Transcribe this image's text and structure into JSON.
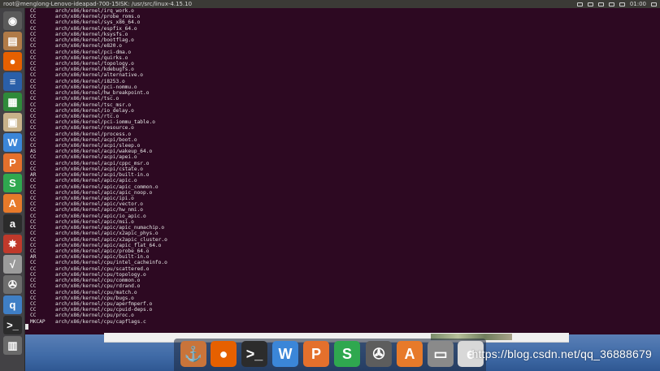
{
  "topbar": {
    "title": "root@menglong-Lenovo-ideapad-700-15ISK: /usr/src/linux-4.15.10",
    "clock": "01:00"
  },
  "terminal": {
    "lines": [
      {
        "action": "CC",
        "target": "arch/x86/kernel/irq_work.o"
      },
      {
        "action": "CC",
        "target": "arch/x86/kernel/probe_roms.o"
      },
      {
        "action": "CC",
        "target": "arch/x86/kernel/sys_x86_64.o"
      },
      {
        "action": "CC",
        "target": "arch/x86/kernel/espfix_64.o"
      },
      {
        "action": "CC",
        "target": "arch/x86/kernel/ksysfs.o"
      },
      {
        "action": "CC",
        "target": "arch/x86/kernel/bootflag.o"
      },
      {
        "action": "CC",
        "target": "arch/x86/kernel/e820.o"
      },
      {
        "action": "CC",
        "target": "arch/x86/kernel/pci-dma.o"
      },
      {
        "action": "CC",
        "target": "arch/x86/kernel/quirks.o"
      },
      {
        "action": "CC",
        "target": "arch/x86/kernel/topology.o"
      },
      {
        "action": "CC",
        "target": "arch/x86/kernel/kdebugfs.o"
      },
      {
        "action": "CC",
        "target": "arch/x86/kernel/alternative.o"
      },
      {
        "action": "CC",
        "target": "arch/x86/kernel/i8253.o"
      },
      {
        "action": "CC",
        "target": "arch/x86/kernel/pci-nommu.o"
      },
      {
        "action": "CC",
        "target": "arch/x86/kernel/hw_breakpoint.o"
      },
      {
        "action": "CC",
        "target": "arch/x86/kernel/tsc.o"
      },
      {
        "action": "CC",
        "target": "arch/x86/kernel/tsc_msr.o"
      },
      {
        "action": "CC",
        "target": "arch/x86/kernel/io_delay.o"
      },
      {
        "action": "CC",
        "target": "arch/x86/kernel/rtc.o"
      },
      {
        "action": "CC",
        "target": "arch/x86/kernel/pci-iommu_table.o"
      },
      {
        "action": "CC",
        "target": "arch/x86/kernel/resource.o"
      },
      {
        "action": "CC",
        "target": "arch/x86/kernel/process.o"
      },
      {
        "action": "CC",
        "target": "arch/x86/kernel/acpi/boot.o"
      },
      {
        "action": "CC",
        "target": "arch/x86/kernel/acpi/sleep.o"
      },
      {
        "action": "AS",
        "target": "arch/x86/kernel/acpi/wakeup_64.o"
      },
      {
        "action": "CC",
        "target": "arch/x86/kernel/acpi/apei.o"
      },
      {
        "action": "CC",
        "target": "arch/x86/kernel/acpi/cppc_msr.o"
      },
      {
        "action": "CC",
        "target": "arch/x86/kernel/acpi/cstate.o"
      },
      {
        "action": "AR",
        "target": "arch/x86/kernel/acpi/built-in.o"
      },
      {
        "action": "CC",
        "target": "arch/x86/kernel/apic/apic.o"
      },
      {
        "action": "CC",
        "target": "arch/x86/kernel/apic/apic_common.o"
      },
      {
        "action": "CC",
        "target": "arch/x86/kernel/apic/apic_noop.o"
      },
      {
        "action": "CC",
        "target": "arch/x86/kernel/apic/ipi.o"
      },
      {
        "action": "CC",
        "target": "arch/x86/kernel/apic/vector.o"
      },
      {
        "action": "CC",
        "target": "arch/x86/kernel/apic/hw_nmi.o"
      },
      {
        "action": "CC",
        "target": "arch/x86/kernel/apic/io_apic.o"
      },
      {
        "action": "CC",
        "target": "arch/x86/kernel/apic/msi.o"
      },
      {
        "action": "CC",
        "target": "arch/x86/kernel/apic/apic_numachip.o"
      },
      {
        "action": "CC",
        "target": "arch/x86/kernel/apic/x2apic_phys.o"
      },
      {
        "action": "CC",
        "target": "arch/x86/kernel/apic/x2apic_cluster.o"
      },
      {
        "action": "CC",
        "target": "arch/x86/kernel/apic/apic_flat_64.o"
      },
      {
        "action": "CC",
        "target": "arch/x86/kernel/apic/probe_64.o"
      },
      {
        "action": "AR",
        "target": "arch/x86/kernel/apic/built-in.o"
      },
      {
        "action": "CC",
        "target": "arch/x86/kernel/cpu/intel_cacheinfo.o"
      },
      {
        "action": "CC",
        "target": "arch/x86/kernel/cpu/scattered.o"
      },
      {
        "action": "CC",
        "target": "arch/x86/kernel/cpu/topology.o"
      },
      {
        "action": "CC",
        "target": "arch/x86/kernel/cpu/common.o"
      },
      {
        "action": "CC",
        "target": "arch/x86/kernel/cpu/rdrand.o"
      },
      {
        "action": "CC",
        "target": "arch/x86/kernel/cpu/match.o"
      },
      {
        "action": "CC",
        "target": "arch/x86/kernel/cpu/bugs.o"
      },
      {
        "action": "CC",
        "target": "arch/x86/kernel/cpu/aperfmperf.o"
      },
      {
        "action": "CC",
        "target": "arch/x86/kernel/cpu/cpuid-deps.o"
      },
      {
        "action": "CC",
        "target": "arch/x86/kernel/cpu/proc.o"
      },
      {
        "action": "MKCAP",
        "target": "arch/x86/kernel/cpu/capflags.c"
      }
    ]
  },
  "launcher": {
    "items": [
      {
        "name": "ubuntu-home-icon",
        "glyph": "◉",
        "color": "#5a5a5a"
      },
      {
        "name": "files-icon",
        "glyph": "▤",
        "color": "#b07a47"
      },
      {
        "name": "firefox-icon",
        "glyph": "●",
        "color": "#e66000"
      },
      {
        "name": "writer-icon",
        "glyph": "≡",
        "color": "#2a5fa8"
      },
      {
        "name": "calc-icon",
        "glyph": "▦",
        "color": "#2f8a3a"
      },
      {
        "name": "archive-icon",
        "glyph": "▣",
        "color": "#c8b28a"
      },
      {
        "name": "wps-writer-icon",
        "glyph": "W",
        "color": "#3b86d8"
      },
      {
        "name": "wps-presentation-icon",
        "glyph": "P",
        "color": "#e4702c"
      },
      {
        "name": "wps-spreadsheet-icon",
        "glyph": "S",
        "color": "#2fa84f"
      },
      {
        "name": "software-center-icon",
        "glyph": "A",
        "color": "#e77a2a"
      },
      {
        "name": "amazon-icon",
        "glyph": "a",
        "color": "#2b2b2b"
      },
      {
        "name": "settings-icon",
        "glyph": "✸",
        "color": "#c0392b"
      },
      {
        "name": "formula-icon",
        "glyph": "√",
        "color": "#9b9b9b"
      },
      {
        "name": "video-icon",
        "glyph": "✇",
        "color": "#6d6d6d"
      },
      {
        "name": "qbittorrent-icon",
        "glyph": "q",
        "color": "#3f7fc5"
      },
      {
        "name": "terminal-icon",
        "glyph": ">_",
        "color": "#2c2c2c"
      },
      {
        "name": "trash-icon",
        "glyph": "▥",
        "color": "#6a6a6a"
      }
    ]
  },
  "dock": {
    "items": [
      {
        "name": "dock-anchor-icon",
        "glyph": "⚓",
        "color": "#c9743a"
      },
      {
        "name": "dock-firefox-icon",
        "glyph": "●",
        "color": "#e66000"
      },
      {
        "name": "dock-terminal-icon",
        "glyph": ">_",
        "color": "#2c2c2c"
      },
      {
        "name": "dock-wps-writer-icon",
        "glyph": "W",
        "color": "#3b86d8"
      },
      {
        "name": "dock-wps-presentation-icon",
        "glyph": "P",
        "color": "#e4702c"
      },
      {
        "name": "dock-wps-spreadsheet-icon",
        "glyph": "S",
        "color": "#2fa84f"
      },
      {
        "name": "dock-video-icon",
        "glyph": "✇",
        "color": "#5d5d5d"
      },
      {
        "name": "dock-software-center-icon",
        "glyph": "A",
        "color": "#e77a2a"
      },
      {
        "name": "dock-drive-icon",
        "glyph": "▭",
        "color": "#8a8a8a"
      },
      {
        "name": "dock-app-icon",
        "glyph": "e",
        "color": "#d8d8d8"
      }
    ],
    "watermark": "https://blog.csdn.net/qq_36888679"
  }
}
